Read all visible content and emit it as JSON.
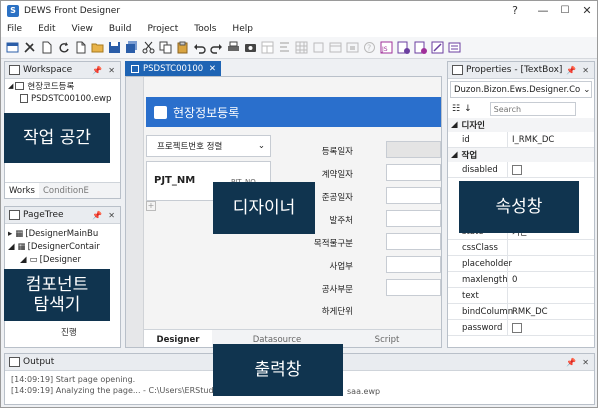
{
  "window": {
    "title": "DEWS Front Designer",
    "help_icon": "?"
  },
  "menu": [
    "File",
    "Edit",
    "View",
    "Build",
    "Project",
    "Tools",
    "Help"
  ],
  "workspace": {
    "title": "Workspace",
    "root": "현장코드등록",
    "file": "PSDSTC00100.ewp",
    "tabs": [
      "Works",
      "ConditionE"
    ],
    "overlay": "작업 공간"
  },
  "pagetree": {
    "title": "PageTree",
    "items": [
      "[DesignerMainBu",
      "[DesignerContair",
      "[Designer",
      "진행"
    ],
    "overlay": "컴포넌트\n탐색기"
  },
  "document": {
    "tab": "PSDSTC00100",
    "header": "현장정보등록",
    "search_label": "프로젝트번호 정렬",
    "project_label": "PJT_NM",
    "project_value": "PJT_NO",
    "form_labels": [
      "등록일자",
      "계약일자",
      "준공일자",
      "발주처",
      "목적물구분",
      "사업부",
      "공사부문",
      "하게단위"
    ],
    "bottom_tabs": [
      "Designer",
      "Datasource",
      "Script"
    ],
    "overlay": "디자이너"
  },
  "properties": {
    "title": "Properties - [TextBox]",
    "selector": "Duzon.Bizon.Ews.Designer.Co",
    "search_placeholder": "Search",
    "category1": "디자인",
    "id_key": "id",
    "id_value": "I_RMK_DC",
    "category2": "작업",
    "disabled_key": "disabled",
    "rows": [
      {
        "k": "state",
        "v": "기본"
      },
      {
        "k": "cssClass",
        "v": ""
      },
      {
        "k": "placeholder",
        "v": ""
      },
      {
        "k": "maxlength",
        "v": "0"
      },
      {
        "k": "text",
        "v": ""
      },
      {
        "k": "bindColumn",
        "v": "RMK_DC"
      },
      {
        "k": "password",
        "v": ""
      }
    ],
    "overlay": "속성창"
  },
  "output": {
    "title": "Output",
    "lines": [
      "[14:09:19]  Start page opening.",
      "[14:09:19]  Analyzing the page... - C:\\Users\\ERStudi",
      "saa.ewp"
    ],
    "overlay": "출력창"
  },
  "colors": {
    "accent": "#1e64b4",
    "overlay": "#10344f"
  }
}
